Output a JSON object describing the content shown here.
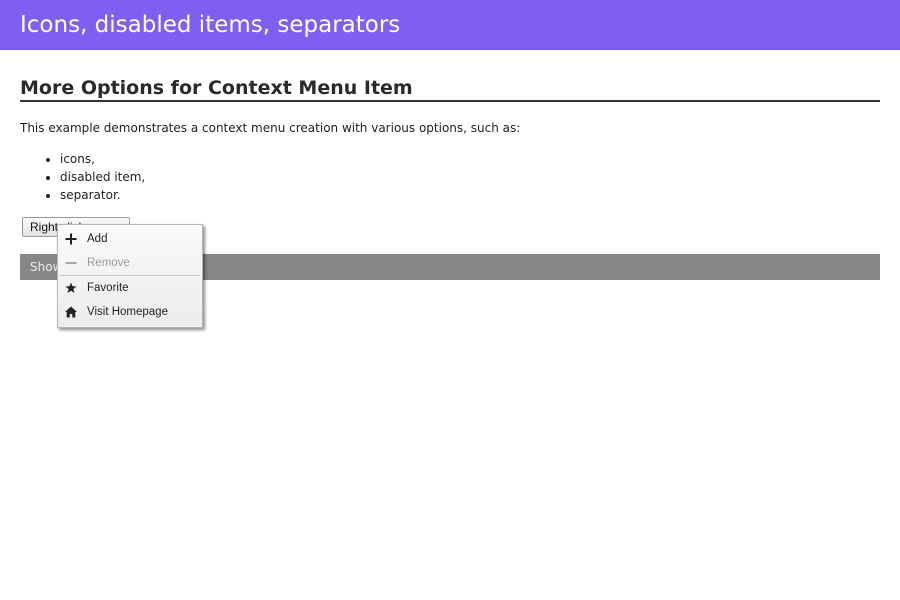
{
  "header": {
    "title": "Icons, disabled items, separators"
  },
  "main": {
    "section_title": "More Options for Context Menu Item",
    "description": "This example demonstrates a context menu creation with various options, such as:",
    "options": [
      "icons,",
      "disabled item,",
      "separator."
    ],
    "trigger_button_label": "Right click me",
    "log_text": "Show your tour"
  },
  "context_menu": {
    "items": [
      {
        "label": "Add",
        "icon": "plus-icon",
        "disabled": false
      },
      {
        "label": "Remove",
        "icon": "minus-icon",
        "disabled": true
      },
      {
        "label": "Favorite",
        "icon": "star-icon",
        "disabled": false
      },
      {
        "label": "Visit Homepage",
        "icon": "home-icon",
        "disabled": false
      }
    ]
  },
  "colors": {
    "header_bg": "#7e5ff2",
    "log_bar_bg": "#878787",
    "disabled_text": "#9a9a9a"
  }
}
